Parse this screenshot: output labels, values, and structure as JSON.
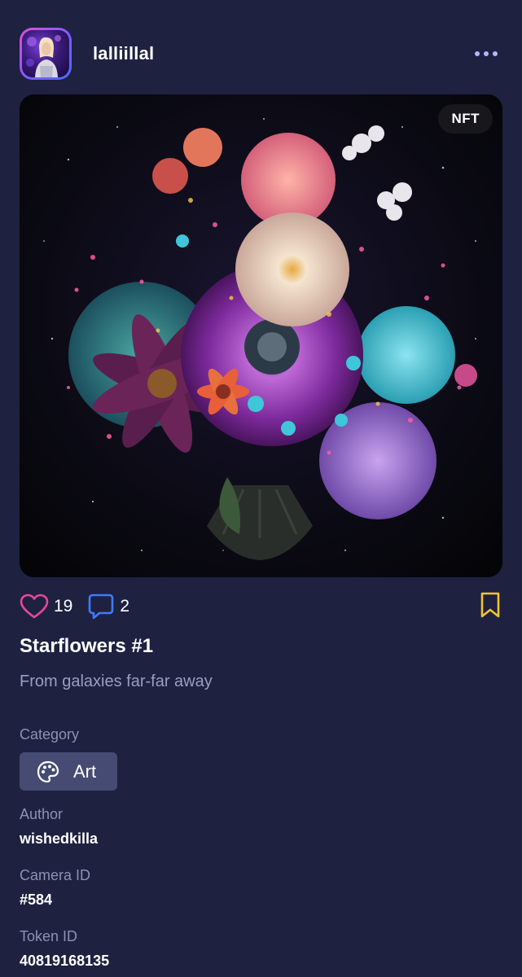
{
  "post": {
    "username": "lalliillal",
    "badge": "NFT",
    "likes": "19",
    "comments": "2",
    "title": "Starflowers #1",
    "description": "From galaxies far-far away"
  },
  "details": {
    "category_label": "Category",
    "category_value": "Art",
    "author_label": "Author",
    "author_value": "wishedkilla",
    "camera_label": "Camera ID",
    "camera_value": "#584",
    "token_label": "Token ID",
    "token_value": "40819168135"
  },
  "icons": {
    "more": "more-horizontal-icon",
    "like": "heart-icon",
    "comment": "comment-icon",
    "bookmark": "bookmark-icon",
    "category": "palette-icon"
  },
  "colors": {
    "background": "#1e2140",
    "heart": "#e8479a",
    "comment": "#3d7bff",
    "bookmark": "#f4c430",
    "chip": "#464b73",
    "muted_text": "#8d92b3"
  }
}
